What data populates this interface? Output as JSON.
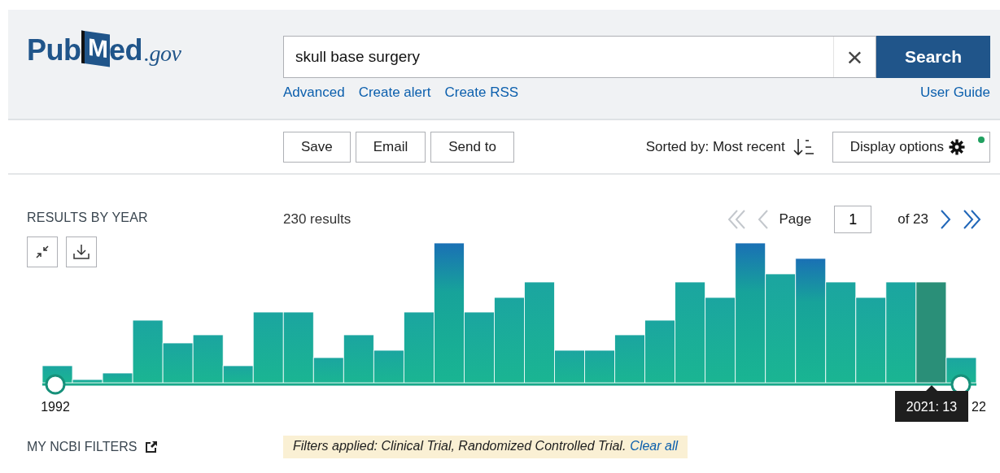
{
  "header": {
    "logo": {
      "prefix": "Pub",
      "badge_letter": "M",
      "rest": "ed",
      "domain": ".gov"
    },
    "search": {
      "value": "skull base surgery",
      "clear_label": "×",
      "button": "Search"
    },
    "links": [
      {
        "label": "Advanced"
      },
      {
        "label": "Create alert"
      },
      {
        "label": "Create RSS"
      }
    ],
    "help_link": "User Guide"
  },
  "toolbar": {
    "buttons": [
      {
        "label": "Save"
      },
      {
        "label": "Email"
      },
      {
        "label": "Send to"
      }
    ],
    "sort": "Sorted by: Most recent",
    "display_options": {
      "label": "Display options",
      "notification": true
    }
  },
  "results": {
    "heading": "RESULTS BY YEAR",
    "count": "230 results",
    "pagination": {
      "first": {
        "disabled": true
      },
      "previous": {
        "disabled": true
      },
      "page_label": "Page",
      "page": "1",
      "total": "of 23",
      "next": {
        "disabled": false
      },
      "last": {
        "disabled": false
      }
    },
    "timeline": {
      "start_label": "1992",
      "end_label": "22",
      "tooltip": "2021: 13"
    }
  },
  "filters": {
    "heading": "MY NCBI FILTERS",
    "note": "*Filters applied: Clinical Trial, Randomized Controlled Trial.*",
    "clear_link": "Clear all"
  }
}
